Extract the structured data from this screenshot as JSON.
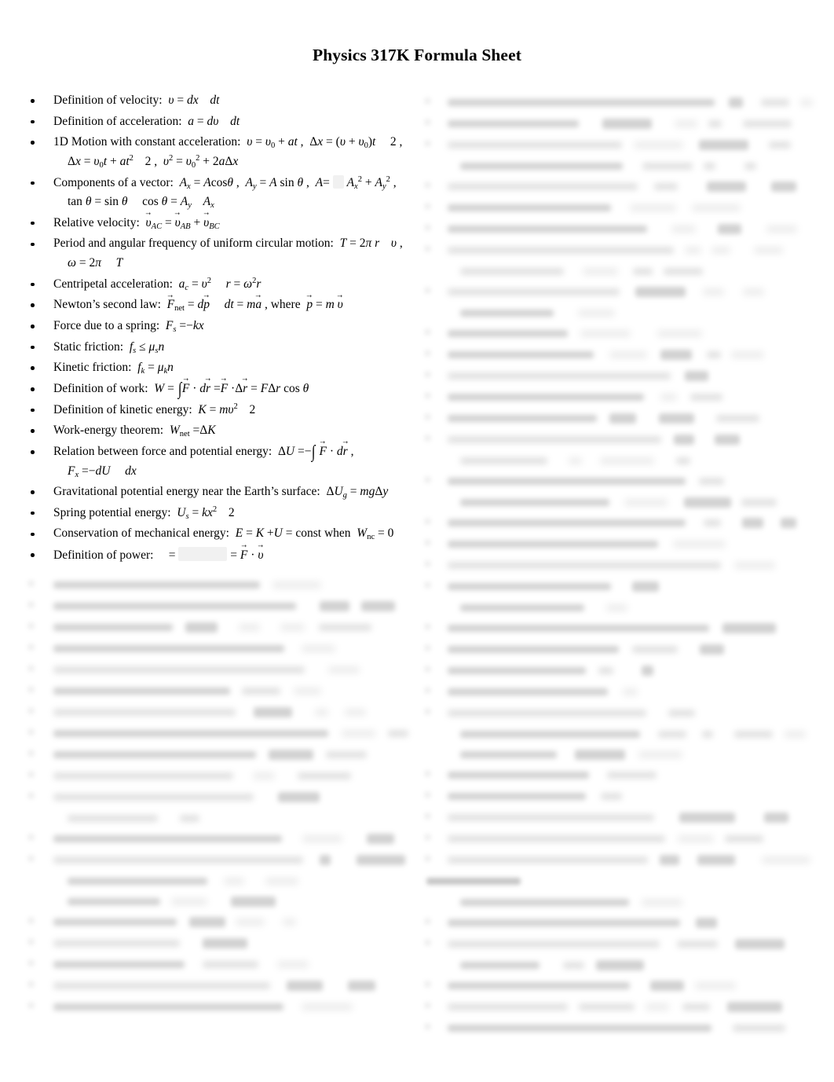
{
  "document": {
    "title": "Physics 317K Formula Sheet",
    "background_color": "#ffffff",
    "text_color": "#000000",
    "layout": "two-column bulleted formula sheet",
    "legibility_note": "Only the upper-left portion of the page is in focus; the remainder of the left column and the entire right column are blurred beyond legibility."
  },
  "left_column": {
    "items": [
      {
        "label": "Definition of velocity:",
        "formula_text": "v = dx dt",
        "legible": true
      },
      {
        "label": "Definition of acceleration:",
        "formula_text": "a = dv dt",
        "legible": true
      },
      {
        "label": "1D Motion with constant acceleration:",
        "formula_text": "v = v0 + at , Δx = (v + v0)t 2 ,",
        "continuation_text": "Δx = v0t + at² 2 , v² = v0² + 2aΔx",
        "legible": true
      },
      {
        "label": "Components of a vector:",
        "formula_text": "Ax = A cosθ , Ay = A sin θ , A = √(Ax² + Ay²) ,",
        "continuation_text": "tan θ = sin θ cos θ = Ay Ax",
        "legible": true
      },
      {
        "label": "Relative velocity:",
        "formula_text": "vAC = vAB + vBC",
        "legible": true
      },
      {
        "label": "Period and angular frequency of uniform circular motion:",
        "formula_text": "T = 2πr v ,",
        "continuation_text": "ω = 2π T",
        "legible": true
      },
      {
        "label": "Centripetal acceleration:",
        "formula_text": "ac = v² r = ω²r",
        "legible": true
      },
      {
        "label": "Newton’s second law:",
        "formula_text": "Fnet = dp dt = ma , where p = mv",
        "legible": true
      },
      {
        "label": "Force due to a spring:",
        "formula_text": "Fs = −kx",
        "legible": true
      },
      {
        "label": "Static friction:",
        "formula_text": "fs ≤ μs n",
        "legible": true
      },
      {
        "label": "Kinetic friction:",
        "formula_text": "fk = μk n",
        "legible": true
      },
      {
        "label": "Definition of work:",
        "formula_text": "W = ∫F · dr = F · Δr = FΔr cos θ",
        "legible": true
      },
      {
        "label": "Definition of kinetic energy:",
        "formula_text": "K = mv² 2",
        "legible": true
      },
      {
        "label": "Work-energy theorem:",
        "formula_text": "Wnet = ΔK",
        "legible": true
      },
      {
        "label": "Relation between force and potential energy:",
        "formula_text": "ΔU = −∫F · dr ,",
        "continuation_text": "Fx = −dU dx",
        "legible": true
      },
      {
        "label": "Gravitational potential energy near the Earth’s surface:",
        "formula_text": "ΔUg = mgΔy",
        "legible": true
      },
      {
        "label": "Spring potential energy:",
        "formula_text": "Us = kx² 2",
        "legible": true
      },
      {
        "label": "Conservation of mechanical energy:",
        "formula_text": "E = K + U = const when Wnc = 0",
        "legible": true
      },
      {
        "label": "Definition of power:",
        "formula_text": "= □ = F · v",
        "legible": true
      }
    ],
    "illegible_region": {
      "starts_after_item": "Definition of power:",
      "note": "Approximately 24 further bulleted formula lines are present but blurred beyond recognition."
    }
  },
  "right_column": {
    "illegible_region": {
      "note": "The entire right column is blurred beyond recognition; roughly 44 bulleted formula lines plus one non-bulleted section heading near the lower third are discernible only as shapes."
    }
  }
}
